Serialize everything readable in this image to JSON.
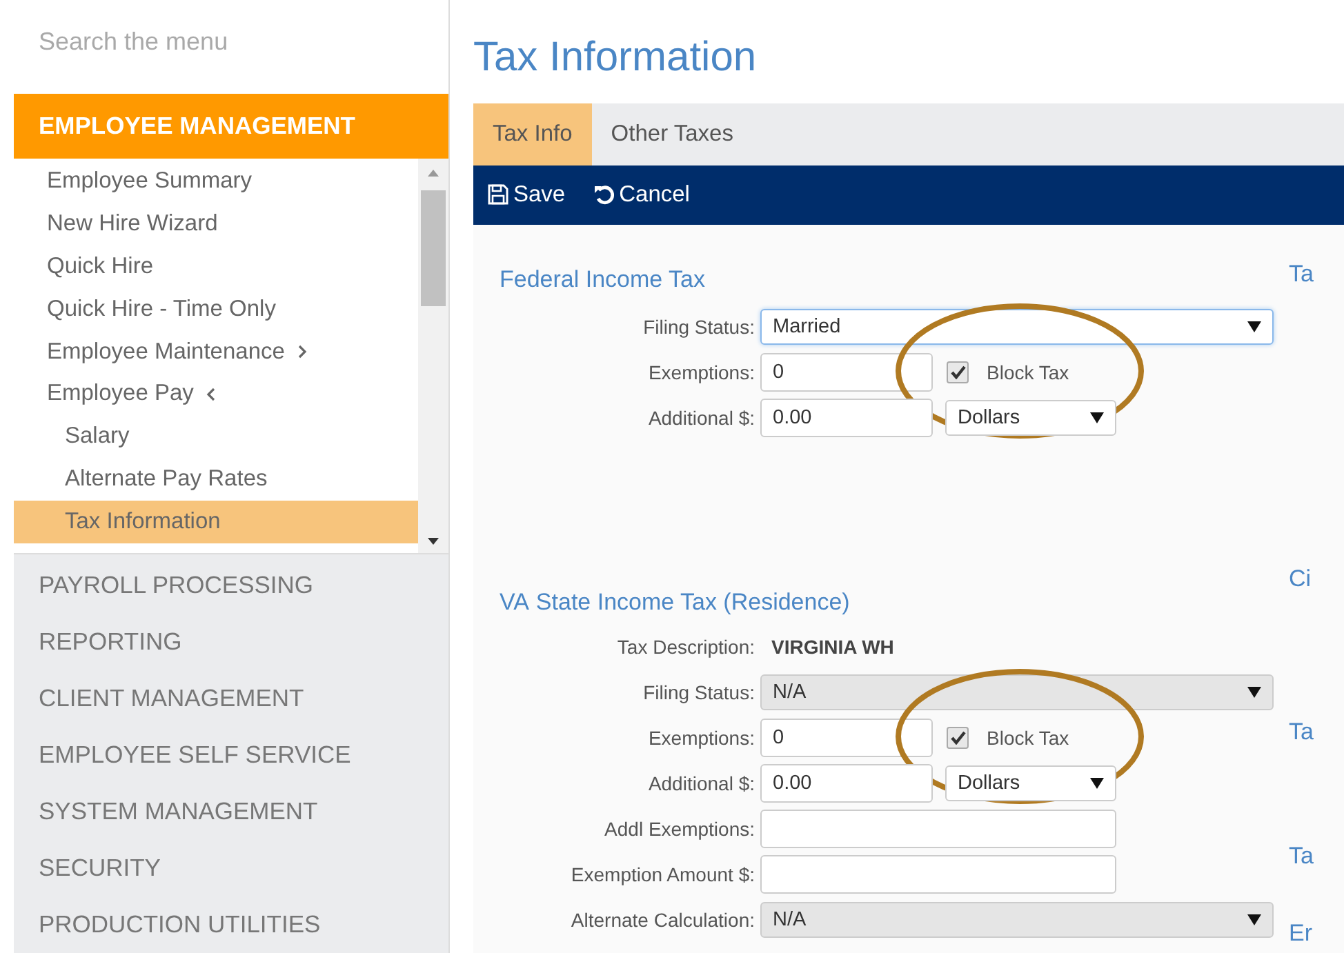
{
  "sidebar": {
    "search": {
      "placeholder": "Search the menu"
    },
    "sections": [
      {
        "label": "EMPLOYEE MANAGEMENT",
        "expanded": true,
        "items": [
          {
            "label": "Employee Summary",
            "selected": false
          },
          {
            "label": "New Hire Wizard",
            "selected": false
          },
          {
            "label": "Quick Hire",
            "selected": false
          },
          {
            "label": "Quick Hire - Time Only",
            "selected": false
          },
          {
            "label": "Employee Maintenance",
            "selected": false,
            "expanded": false
          },
          {
            "label": "Employee Pay",
            "selected": false,
            "expanded": true,
            "children": [
              {
                "label": "Salary",
                "selected": false
              },
              {
                "label": "Alternate Pay Rates",
                "selected": false
              },
              {
                "label": "Tax Information",
                "selected": true
              }
            ]
          }
        ]
      },
      {
        "label": "PAYROLL PROCESSING",
        "expanded": false
      },
      {
        "label": "REPORTING",
        "expanded": false
      },
      {
        "label": "CLIENT MANAGEMENT",
        "expanded": false
      },
      {
        "label": "EMPLOYEE SELF SERVICE",
        "expanded": false
      },
      {
        "label": "SYSTEM MANAGEMENT",
        "expanded": false
      },
      {
        "label": "SECURITY",
        "expanded": false
      },
      {
        "label": "PRODUCTION UTILITIES",
        "expanded": false
      }
    ]
  },
  "page": {
    "title": "Tax Information"
  },
  "tabs": [
    {
      "label": "Tax Info",
      "selected": true
    },
    {
      "label": "Other Taxes",
      "selected": false
    }
  ],
  "toolbar": [
    {
      "label": "Save",
      "kind": "save"
    },
    {
      "label": "Cancel",
      "kind": "undo"
    }
  ],
  "sections": [
    {
      "title": "Federal Income Tax",
      "fields": [
        {
          "label": "Filing Status:",
          "kind": "select",
          "value": "Married",
          "focused": true,
          "disabled": false
        },
        {
          "label": "Exemptions:",
          "kind": "input",
          "value": "0",
          "checkbox": {
            "label": "Block Tax",
            "checked": true
          },
          "circled": true
        },
        {
          "label": "Additional $:",
          "kind": "input",
          "value": "0.00",
          "select": {
            "value": "Dollars"
          }
        }
      ]
    },
    {
      "prefix": "VA",
      "title": "State Income Tax (Residence)",
      "fields": [
        {
          "label": "Tax Description:",
          "kind": "text",
          "value": "VIRGINIA WH"
        },
        {
          "label": "Filing Status:",
          "kind": "select",
          "value": "N/A",
          "focused": false,
          "disabled": true
        },
        {
          "label": "Exemptions:",
          "kind": "input",
          "value": "0",
          "checkbox": {
            "label": "Block Tax",
            "checked": true
          },
          "circled": true
        },
        {
          "label": "Additional $:",
          "kind": "input",
          "value": "0.00",
          "select": {
            "value": "Dollars"
          }
        },
        {
          "label": "Addl Exemptions:",
          "kind": "input"
        },
        {
          "label": "Exemption Amount $:",
          "kind": "input"
        },
        {
          "label": "Alternate Calculation:",
          "kind": "select",
          "value": "N/A",
          "focused": false,
          "disabled": true
        }
      ]
    }
  ],
  "side_headings": [
    "Ta",
    "Ci",
    "Ta",
    "Ta",
    "Er"
  ]
}
